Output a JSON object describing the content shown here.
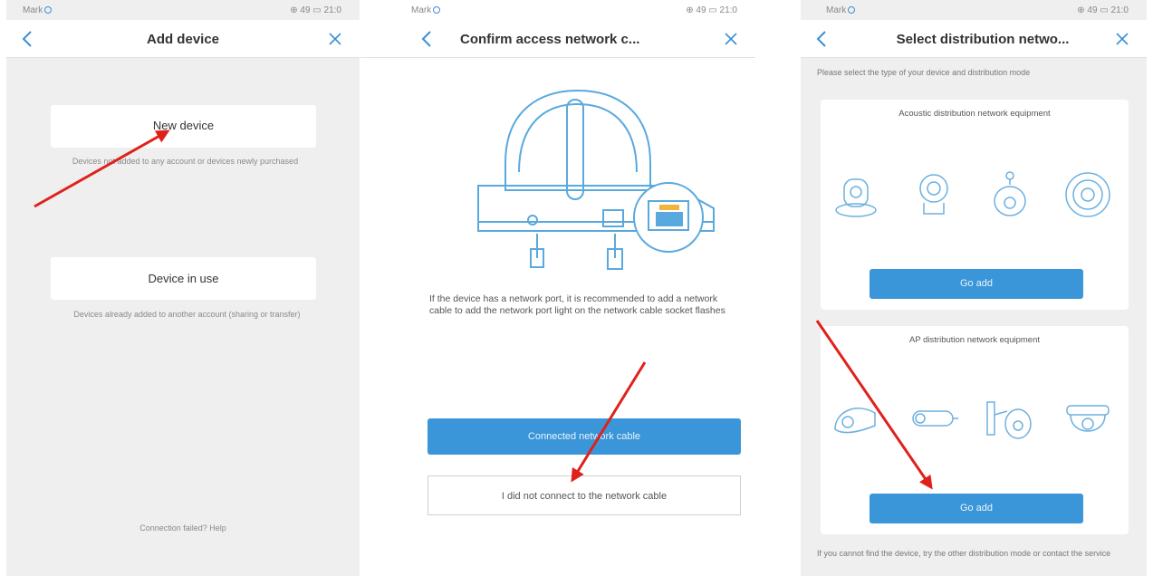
{
  "panel1": {
    "status": {
      "carrier": "Mark",
      "right": "⊕ 49 ▭ 21:0"
    },
    "title": "Add device",
    "new_device": {
      "label": "New device",
      "desc": "Devices not added to any account or devices newly purchased"
    },
    "device_in_use": {
      "label": "Device in use",
      "desc": "Devices already added to another account (sharing or transfer)"
    },
    "footer": "Connection failed? Help"
  },
  "panel2": {
    "status": {
      "carrier": "Mark",
      "right": "⊕ 49 ▭ 21:0"
    },
    "title": "Confirm access network c...",
    "instruction": "If the device has a network port, it is recommended to add a network cable to add the network port light on the network cable socket flashes",
    "connected_button": "Connected network cable",
    "not_connected_button": "I did not connect to the network cable"
  },
  "panel3": {
    "status": {
      "carrier": "Mark",
      "right": "⊕ 49 ▭ 21:0"
    },
    "title": "Select distribution netwo...",
    "intro": "Please select the type of your device and distribution mode",
    "section1_title": "Acoustic distribution network equipment",
    "section1_button": "Go add",
    "section2_title": "AP distribution network equipment",
    "section2_button": "Go add",
    "footer": "If you cannot find the device, try the other distribution mode or contact the service"
  },
  "colors": {
    "accent": "#3a96d8",
    "annotation_arrow": "#e0211b"
  }
}
